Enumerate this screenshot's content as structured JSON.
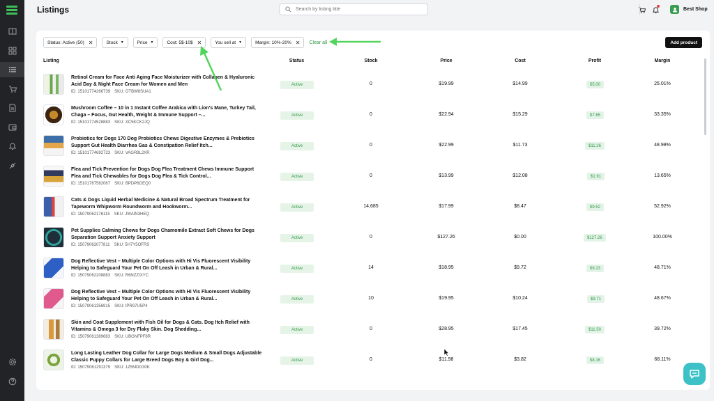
{
  "app": {
    "page_title": "Listings",
    "search_placeholder": "Search by listing title",
    "shop_name": "Best Shop",
    "accent": "#2e9a47"
  },
  "filters": {
    "chips": [
      {
        "label": "Status: Active (50)",
        "removable": true
      },
      {
        "label": "Stock",
        "dropdown": true
      },
      {
        "label": "Price",
        "dropdown": true
      },
      {
        "label": "Cost: 5$-10$",
        "removable": true
      },
      {
        "label": "You sell at",
        "dropdown": true
      },
      {
        "label": "Margin: 10%-20%",
        "removable": true
      }
    ],
    "clear_all": "Clear all",
    "add_product": "Add product"
  },
  "table": {
    "headers": {
      "listing": "Listing",
      "status": "Status",
      "stock": "Stock",
      "price": "Price",
      "cost": "Cost",
      "profit": "Profit",
      "margin": "Margin"
    },
    "rows": [
      {
        "title": "Retinol Cream for Face Anti Aging Face Moisturizer with Collagen & Hyaluronic Acid Day & Night Face Cream for Women and Men",
        "id": "ID: 15101774266739",
        "sku": "SKU: OTBW8SUA1",
        "status": "Active",
        "stock": "0",
        "price": "$19.99",
        "cost": "$14.99",
        "profit": "$5.00",
        "margin": "25.01%"
      },
      {
        "title": "Mushroom Coffee – 10 in 1 Instant Coffee Arabica with Lion's Mane, Turkey Tail, Chaga – Focus, Gut Health, Weight & Immune Support –...",
        "id": "ID: 15101774528883",
        "sku": "SKU: XC5KCK2JQ",
        "status": "Active",
        "stock": "0",
        "price": "$22.94",
        "cost": "$15.29",
        "profit": "$7.65",
        "margin": "33.35%"
      },
      {
        "title": "Probiotics for Dogs 170 Dog Probiotics Chews Digestive Enzymes & Prebiotics Support Gut Health Diarrhea Gas & Constipation Relief Itch...",
        "id": "ID: 15101774692723",
        "sku": "SKU: VAGR9L2XR",
        "status": "Active",
        "stock": "0",
        "price": "$22.99",
        "cost": "$11.73",
        "profit": "$11.26",
        "margin": "48.98%"
      },
      {
        "title": "Flea and Tick Prevention for Dogs Dog Flea Treatment Chews Immune Support Flea and Tick Chewables for Dogs Dog Flea & Tick Control...",
        "id": "ID: 15101767582067",
        "sku": "SKU: BPDP6GEQ0",
        "status": "Active",
        "stock": "0",
        "price": "$13.99",
        "cost": "$12.08",
        "profit": "$1.91",
        "margin": "13.65%"
      },
      {
        "title": "Cats & Dogs Liquid Herbal Medicine & Natural Broad Spectrum Treatment for Tapeworm Whipworm Roundworm and Hookworm...",
        "id": "ID: 15079062176115",
        "sku": "SKU: JWAIN3HEQ",
        "status": "Active",
        "stock": "14,685",
        "price": "$17.99",
        "cost": "$8.47",
        "profit": "$9.52",
        "margin": "52.92%"
      },
      {
        "title": "Pet Supplies Calming Chews for Dogs Chamomile Extract Soft Chews for Dogs Separation Support Anxiety Support",
        "id": "ID: 15079062077811",
        "sku": "SKU: 5H7Y5OFRS",
        "status": "Active",
        "stock": "0",
        "price": "$127.26",
        "cost": "$0.00",
        "profit": "$127.26",
        "margin": "100.00%"
      },
      {
        "title": "Dog Reflective Vest – Multiple Color Options with Hi Vis Fluorescent Visibility Helping to Safeguard Your Pet On Off Leash in Urban & Rural...",
        "id": "ID: 15079062208883",
        "sku": "SKU: R6NZZIXYC",
        "status": "Active",
        "stock": "14",
        "price": "$18.95",
        "cost": "$9.72",
        "profit": "$9.23",
        "margin": "48.71%"
      },
      {
        "title": "Dog Reflective Vest – Multiple Color Options with Hi Vis Fluorescent Visibility Helping to Safeguard Your Pet On Off Leash in Urban & Rural...",
        "id": "ID: 15079061356915",
        "sku": "SKU: IPR97U5P4",
        "status": "Active",
        "stock": "10",
        "price": "$19.95",
        "cost": "$10.24",
        "profit": "$9.71",
        "margin": "48.67%"
      },
      {
        "title": "Skin and Coat Supplement with Fish Oil for Dogs & Cats. Dog Itch Relief with Vitamins & Omega 3 for Dry Flaky Skin. Dog Shedding...",
        "id": "ID: 15079061389683",
        "sku": "SKU: UBGNFPF8R",
        "status": "Active",
        "stock": "0",
        "price": "$28.95",
        "cost": "$17.45",
        "profit": "$11.50",
        "margin": "39.72%"
      },
      {
        "title": "Long Lasting Leather Dog Collar for Large Dogs Medium & Small Dogs Adjustable Classic Puppy Collars for Large Breed Dogs Boy & Girl Dog...",
        "id": "ID: 15079061291379",
        "sku": "SKU: 1Z5MDG30K",
        "status": "Active",
        "stock": "0",
        "price": "$11.98",
        "cost": "$3.82",
        "profit": "$8.16",
        "margin": "68.11%"
      }
    ]
  }
}
